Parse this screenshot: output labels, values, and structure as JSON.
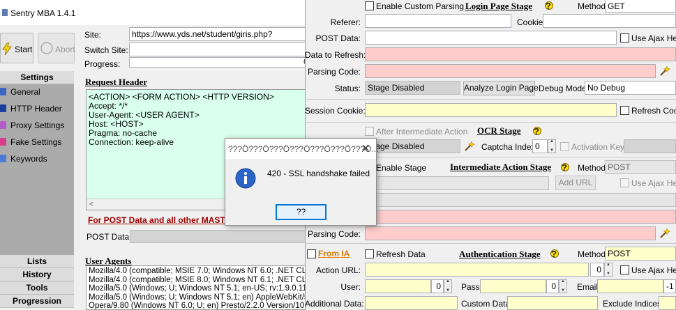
{
  "left": {
    "title": "Sentry MBA 1.4.1",
    "start_label": "Start",
    "abort_label": "Abort",
    "site_label": "Site:",
    "site_value": "https://www.yds.net/student/giris.php?",
    "switch_site_label": "Switch Site:",
    "progress_label": "Progress:",
    "progress_text": "0%",
    "settings_header": "Settings",
    "nav_items": [
      "General",
      "HTTP Header",
      "Proxy Settings",
      "Fake Settings",
      "Keywords"
    ],
    "request_header_title": "Request Header",
    "request_header_lines": [
      "<ACTION> <FORM ACTION> <HTTP VERSION>",
      "Accept: */*",
      "User-Agent: <USER AGENT>",
      "Host: <HOST>",
      "Pragma: no-cache",
      "Connection: keep-alive"
    ],
    "post_note": "For POST Data and all other MAST",
    "post_data_label": "POST Data:",
    "bottom_tabs": [
      "Lists",
      "History",
      "Tools",
      "Progression"
    ],
    "user_agents_title": "User Agents",
    "user_agents": [
      "Mozilla/4.0 (compatible; MSIE 7.0; Windows NT 6.0; .NET CLR 1",
      "Mozilla/4.0 (compatible; MSIE 8.0; Windows NT 6.1; .NET CLR 1",
      "Mozilla/5.0 (Windows; U; Windows NT 5.1; en-US; rv:1.9.0.11) G",
      "Mozilla/5.0 (Windows; U; Windows NT 5.1; en) AppleWebKit/522",
      "Opera/9.80 (Windows NT 6.0; U; en) Presto/2.2.0 Version/10.00"
    ]
  },
  "right": {
    "login": {
      "enable_label": "Enable Custom Parsing",
      "title": "Login Page Stage",
      "method_label": "Method:",
      "method_value": "GET",
      "referer_label": "Referer:",
      "cookie_label": "Cookie:",
      "post_data_label": "POST Data:",
      "use_ajax_label": "Use Ajax Hea",
      "data_refresh_label": "Data to Refresh:",
      "parsing_code_label": "Parsing Code:",
      "status_label": "Status:",
      "status_value": "Stage Disabled",
      "analyze_label": "Analyze Login Page",
      "debug_label": "Debug Mode:",
      "debug_value": "No Debug",
      "session_cookie_label": "Session Cookie:",
      "refresh_cookie_label": "Refresh Cook"
    },
    "ocr": {
      "after_label": "After Intermediate Action",
      "title": "OCR Stage",
      "status_value": "Stage Disabled",
      "captcha_index_label": "Captcha Index:",
      "captcha_index_value": "0",
      "activation_key_label": "Activation Key:"
    },
    "intermediate": {
      "enable_label": "Enable Stage",
      "title": "Intermediate Action Stage",
      "method_label": "Method:",
      "method_value": "POST",
      "add_url_label": "Add URL",
      "use_ajax_label": "Use Ajax Hea",
      "parsing_code_label": "Parsing Code:"
    },
    "auth": {
      "from_ia_label": "From IA",
      "refresh_label": "Refresh Data",
      "title": "Authentication Stage",
      "method_label": "Method:",
      "method_value": "POST",
      "action_url_label": "Action URL:",
      "action_url_index": "0",
      "use_ajax_label": "Use Ajax Hea",
      "user_label": "User:",
      "user_value": "0",
      "pass_label": "Pass:",
      "pass_value": "0",
      "email_label": "Email:",
      "email_value": "-1",
      "additional_label": "Additional Data:",
      "custom_label": "Custom Data:",
      "exclude_label": "Exclude Indices:"
    }
  },
  "dialog": {
    "title": "???Ö???Ö???Ö???Ö???Ö???Ö???Ö...",
    "message": "420 - SSL handshake failed",
    "ok_label": "??"
  },
  "colors": {
    "pink": "#ffcccc",
    "yellow": "#ffffcc",
    "request_bg": "#d9ffee",
    "link_red": "#a00000",
    "from_ia": "#d97a00"
  }
}
